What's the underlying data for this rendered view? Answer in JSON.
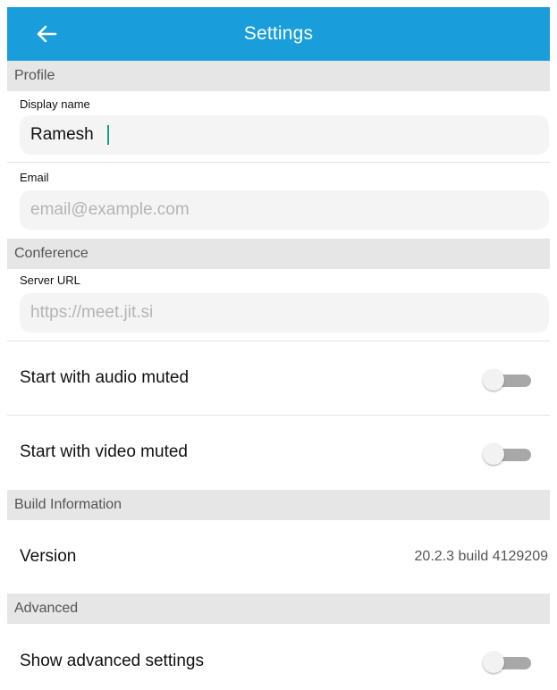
{
  "header": {
    "title": "Settings",
    "back_icon": "arrow-left-icon"
  },
  "sections": {
    "profile": "Profile",
    "conference": "Conference",
    "build_information": "Build Information",
    "advanced": "Advanced"
  },
  "profile": {
    "display_name_label": "Display name",
    "display_name_value": "Ramesh",
    "email_label": "Email",
    "email_value": "",
    "email_placeholder": "email@example.com"
  },
  "conference": {
    "server_url_label": "Server URL",
    "server_url_value": "",
    "server_url_placeholder": "https://meet.jit.si",
    "audio_muted_label": "Start with audio muted",
    "audio_muted_on": false,
    "video_muted_label": "Start with video muted",
    "video_muted_on": false
  },
  "build": {
    "version_label": "Version",
    "version_value": "20.2.3 build 4129209"
  },
  "advanced": {
    "show_advanced_label": "Show advanced settings",
    "show_advanced_on": false
  },
  "colors": {
    "header": "#1a9edb",
    "section_bg": "#e6e6e6",
    "caret": "#1a9e7e"
  }
}
